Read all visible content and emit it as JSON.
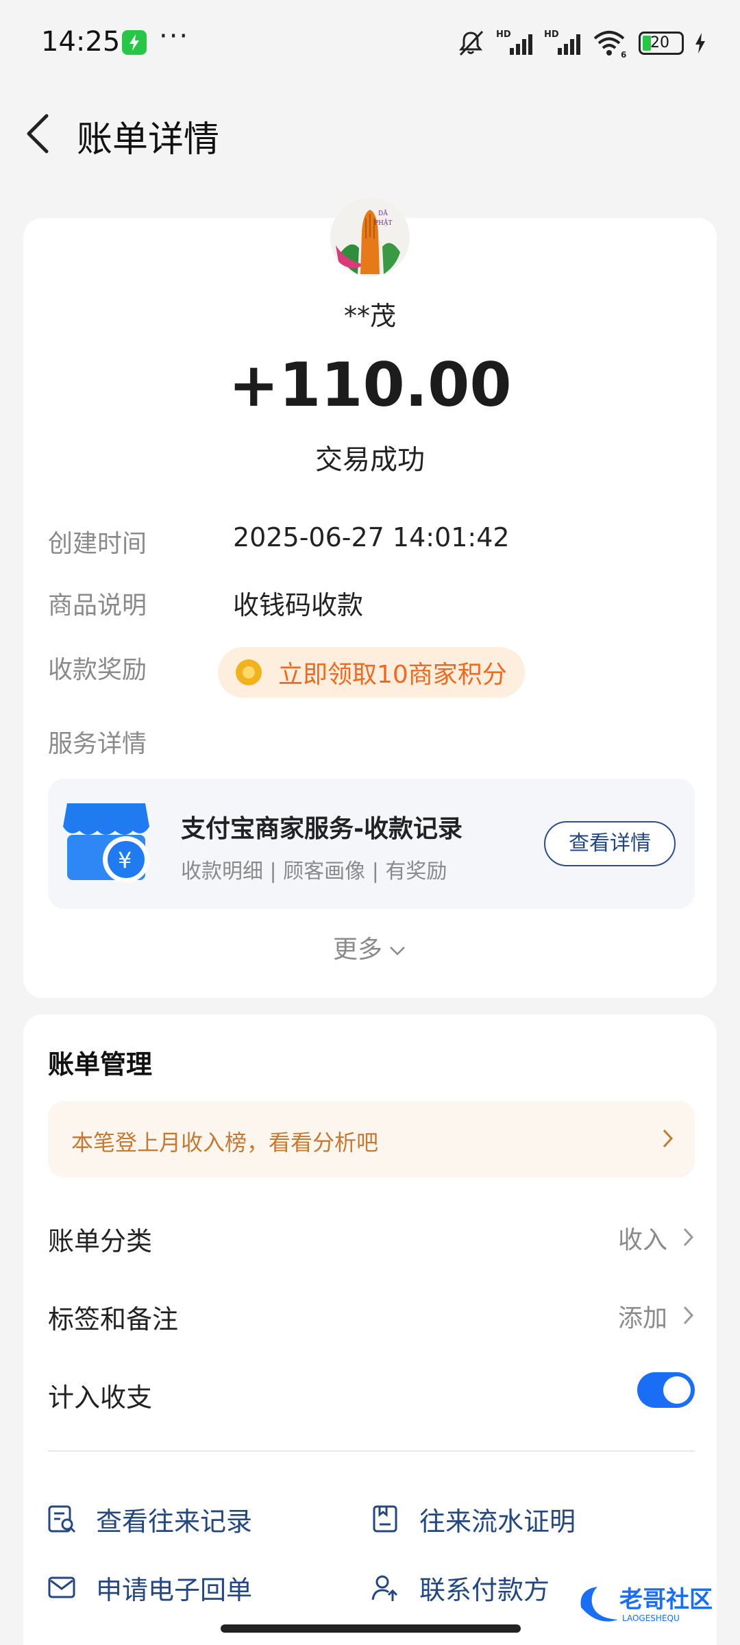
{
  "status_bar": {
    "time": "14:25",
    "dots": "···",
    "battery": "20",
    "icons": [
      "charging-app-icon",
      "mute-icon",
      "hd-signal-icon",
      "hd-signal-icon",
      "wifi-6-icon",
      "battery-icon",
      "charging-bolt-icon"
    ]
  },
  "header": {
    "title": "账单详情"
  },
  "payment": {
    "payer": "**茂",
    "amount": "+110.00",
    "status": "交易成功",
    "avatar_text": "PHẬT"
  },
  "details": {
    "created_label": "创建时间",
    "created_value": "2025-06-27 14:01:42",
    "product_label": "商品说明",
    "product_value": "收钱码收款",
    "reward_label": "收款奖励",
    "reward_text": "立即领取10商家积分",
    "service_label": "服务详情"
  },
  "service": {
    "title": "支付宝商家服务-收款记录",
    "subtitle": "收款明细 | 顾客画像 | 有奖励",
    "button": "查看详情"
  },
  "more_label": "更多",
  "bill_management": {
    "title": "账单管理",
    "banner": "本笔登上月收入榜，看看分析吧",
    "category_label": "账单分类",
    "category_value": "收入",
    "tags_label": "标签和备注",
    "tags_value": "添加",
    "include_label": "计入收支",
    "include_on": true,
    "actions": [
      "查看往来记录",
      "往来流水证明",
      "申请电子回单",
      "联系付款方"
    ]
  },
  "watermark": {
    "text": "老哥社区",
    "sub": "LAOGESHEQU"
  },
  "colors": {
    "accent": "#1a6ef5",
    "link": "#23477e",
    "reward": "#ee6a20",
    "banner_text": "#c57a33"
  }
}
